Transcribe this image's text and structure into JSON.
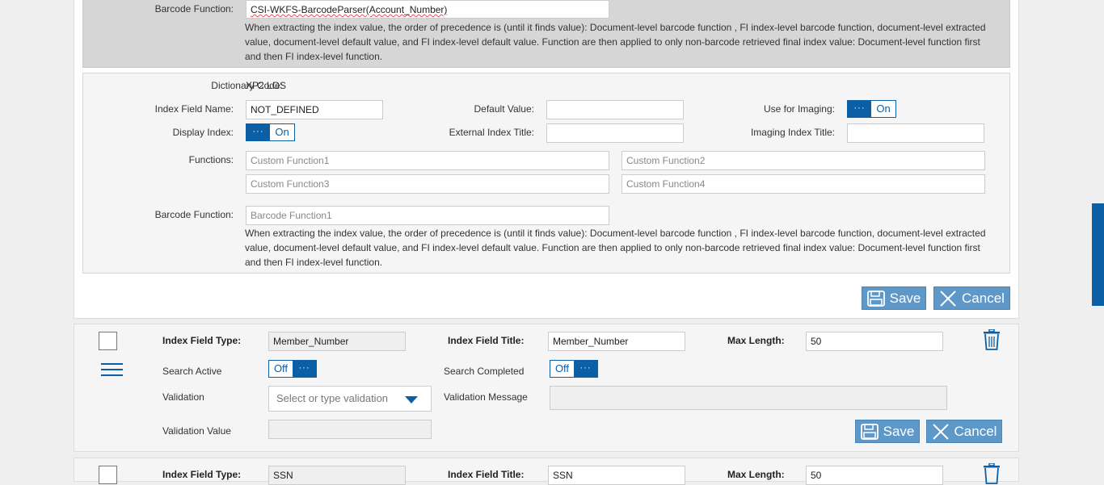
{
  "doc_panel": {
    "barcode_label": "Barcode Function:",
    "barcode_value": "CSI-WKFS-BarcodeParser(Account_Number)",
    "help_text": "When extracting the index value, the order of precedence is (until it finds value): Document-level barcode function , FI index-level barcode function, document-level extracted value, document-level default value, and FI index-level default value. Function are then applied to only non-barcode retrieved final index value: Document-level function first and then FI index-level function."
  },
  "index_panel": {
    "dictionary_label": "Dictionary Code:",
    "dictionary_value": "XP2 LOS",
    "index_field_name_label": "Index Field Name:",
    "index_field_name_value": "NOT_DEFINED",
    "default_value_label": "Default Value:",
    "default_value_value": "",
    "use_for_imaging_label": "Use for Imaging:",
    "use_for_imaging_state": "On",
    "display_index_label": "Display Index:",
    "display_index_state": "On",
    "external_index_title_label": "External Index Title:",
    "external_index_title_value": "",
    "imaging_index_title_label": "Imaging Index Title:",
    "imaging_index_title_value": "",
    "functions_label": "Functions:",
    "function1_placeholder": "Custom Function1",
    "function2_placeholder": "Custom Function2",
    "function3_placeholder": "Custom Function3",
    "function4_placeholder": "Custom Function4",
    "barcode_label": "Barcode Function:",
    "barcode_placeholder": "Barcode Function1",
    "help_text": "When extracting the index value, the order of precedence is (until it finds value): Document-level barcode function , FI index-level barcode function, document-level extracted value, document-level default value, and FI index-level default value. Function are then applied to only non-barcode retrieved final index value: Document-level function first and then FI index-level function.",
    "toggle_dots": "···",
    "save_label": "Save",
    "cancel_label": "Cancel"
  },
  "row1": {
    "index_field_type_label": "Index Field Type:",
    "index_field_type_value": "Member_Number",
    "index_field_title_label": "Index Field Title:",
    "index_field_title_value": "Member_Number",
    "max_length_label": "Max Length:",
    "max_length_value": "50",
    "search_active_label": "Search Active",
    "search_active_state": "Off",
    "search_completed_label": "Search Completed",
    "search_completed_state": "Off",
    "validation_label": "Validation",
    "validation_placeholder": "Select or type validation",
    "validation_message_label": "Validation Message",
    "validation_value_label": "Validation Value",
    "save_label": "Save",
    "cancel_label": "Cancel"
  },
  "row2": {
    "index_field_type_label": "Index Field Type:",
    "index_field_type_value": "SSN",
    "index_field_title_label": "Index Field Title:",
    "index_field_title_value": "SSN",
    "max_length_label": "Max Length:",
    "max_length_value": "50"
  },
  "colors": {
    "accent": "#0b5fa5",
    "button": "#5e98c8"
  }
}
